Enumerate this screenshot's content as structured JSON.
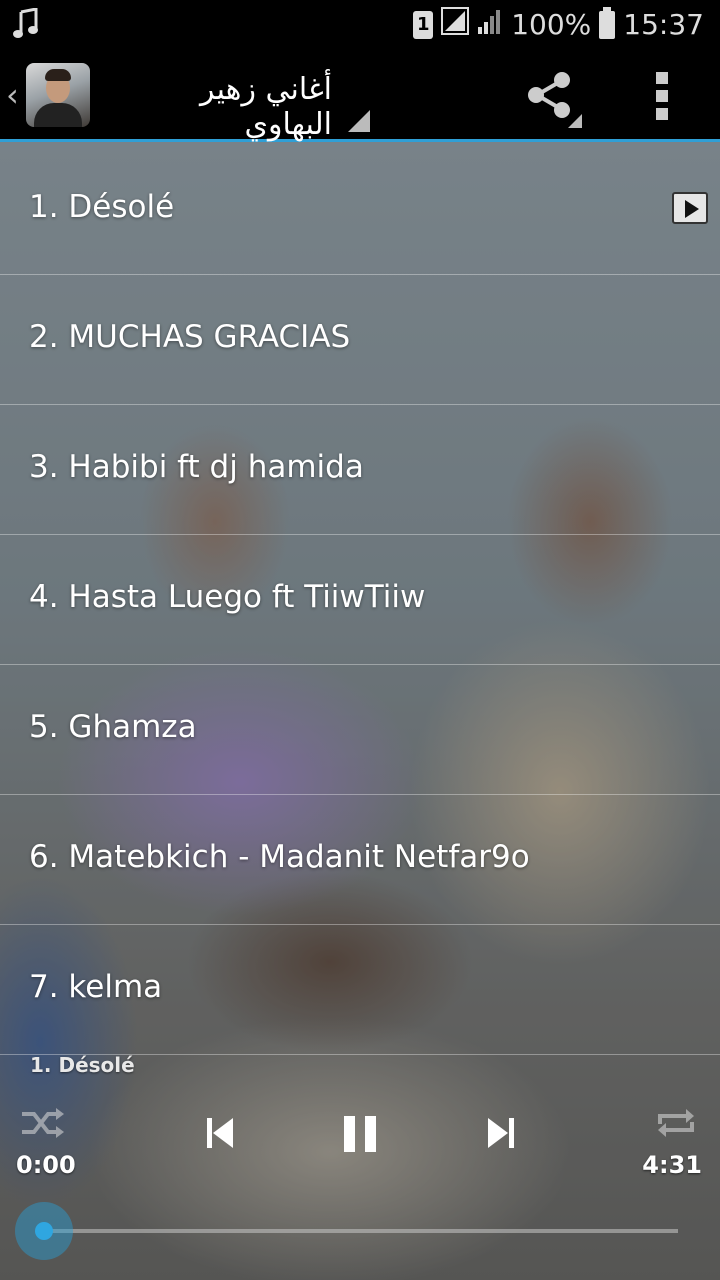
{
  "status_bar": {
    "sim_slot": "1",
    "battery_percent": "100%",
    "time": "15:37",
    "icons": [
      "music-note-icon",
      "sim-card-icon",
      "signal-box-icon",
      "signal-bars-icon",
      "battery-icon"
    ]
  },
  "action_bar": {
    "title": "أغاني زهير البهاوي",
    "icons": [
      "back-chevron-icon",
      "share-icon",
      "overflow-menu-icon"
    ]
  },
  "songs": [
    {
      "label": "1. Désolé"
    },
    {
      "label": "2. MUCHAS GRACIAS"
    },
    {
      "label": "3. Habibi ft dj hamida"
    },
    {
      "label": "4. Hasta Luego ft TiiwTiiw"
    },
    {
      "label": "5. Ghamza"
    },
    {
      "label": "6. Matebkich - Madanit Netfar9o"
    },
    {
      "label": "7. kelma"
    }
  ],
  "player": {
    "now_playing": "1. Désolé",
    "current_time": "0:00",
    "total_time": "4:31",
    "progress_fraction": 0.0,
    "accent_color": "#2fa6e0",
    "controls": [
      "shuffle-icon",
      "previous-icon",
      "pause-icon",
      "next-icon",
      "repeat-icon"
    ]
  }
}
